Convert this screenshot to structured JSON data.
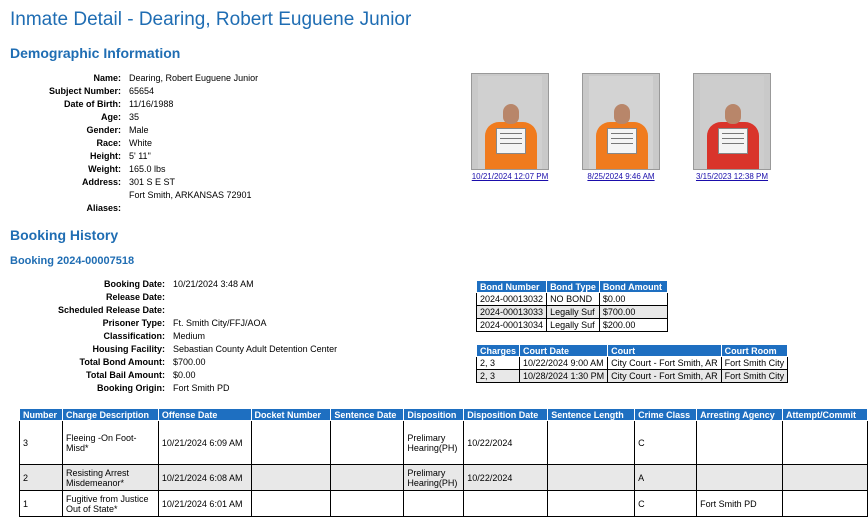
{
  "page_title": "Inmate Detail - Dearing, Robert Euguene Junior",
  "demographic": {
    "heading": "Demographic Information",
    "rows": [
      {
        "label": "Name:",
        "value": "Dearing, Robert Euguene Junior"
      },
      {
        "label": "Subject Number:",
        "value": "65654"
      },
      {
        "label": "Date of Birth:",
        "value": "11/16/1988"
      },
      {
        "label": "Age:",
        "value": "35"
      },
      {
        "label": "Gender:",
        "value": "Male"
      },
      {
        "label": "Race:",
        "value": "White"
      },
      {
        "label": "Height:",
        "value": "5' 11\""
      },
      {
        "label": "Weight:",
        "value": "165.0 lbs"
      },
      {
        "label": "Address:",
        "value": "301 S E ST",
        "value2": "Fort Smith, ARKANSAS 72901"
      },
      {
        "label": "Aliases:",
        "value": ""
      }
    ]
  },
  "photos": [
    {
      "caption": "10/21/2024 12:07 PM",
      "shirt": "#f07b1e",
      "wall": "#d0d0d0"
    },
    {
      "caption": "8/25/2024 9:46 AM",
      "shirt": "#f07b1e",
      "wall": "#d3d3d3"
    },
    {
      "caption": "3/15/2023 12:38 PM",
      "shirt": "#d9342b",
      "wall": "#cdcdcd"
    }
  ],
  "booking_history": {
    "heading": "Booking History",
    "booking_title": "Booking 2024-00007518",
    "rows": [
      {
        "label": "Booking Date:",
        "value": "10/21/2024 3:48 AM"
      },
      {
        "label": "Release Date:",
        "value": ""
      },
      {
        "label": "Scheduled Release Date:",
        "value": ""
      },
      {
        "label": "Prisoner Type:",
        "value": "Ft. Smith City/FFJ/AOA"
      },
      {
        "label": "Classification:",
        "value": "Medium"
      },
      {
        "label": "Housing Facility:",
        "value": "Sebastian County Adult Detention Center"
      },
      {
        "label": "Total Bond Amount:",
        "value": "$700.00"
      },
      {
        "label": "Total Bail Amount:",
        "value": "$0.00"
      },
      {
        "label": "Booking Origin:",
        "value": "Fort Smith PD"
      }
    ]
  },
  "bonds": {
    "headers": [
      "Bond Number",
      "Bond Type",
      "Bond Amount"
    ],
    "rows": [
      [
        "2024-00013032",
        "NO BOND",
        "$0.00"
      ],
      [
        "2024-00013033",
        "Legally Suf",
        "$700.00"
      ],
      [
        "2024-00013034",
        "Legally Suf",
        "$200.00"
      ]
    ]
  },
  "court": {
    "headers": [
      "Charges",
      "Court Date",
      "Court",
      "Court Room"
    ],
    "rows": [
      [
        "2, 3",
        "10/22/2024 9:00 AM",
        "City Court - Fort Smith, AR",
        "Fort Smith City"
      ],
      [
        "2, 3",
        "10/28/2024 1:30 PM",
        "City Court - Fort Smith, AR",
        "Fort Smith City"
      ]
    ]
  },
  "charges": {
    "headers": [
      "Number",
      "Charge Description",
      "Offense Date",
      "Docket Number",
      "Sentence Date",
      "Disposition",
      "Disposition Date",
      "Sentence Length",
      "Crime Class",
      "Arresting Agency",
      "Attempt/Commit"
    ],
    "rows": [
      [
        "3",
        "Fleeing -On Foot-Misd*",
        "10/21/2024 6:09 AM",
        "",
        "",
        "Prelimary Hearing(PH)",
        "10/22/2024",
        "",
        "C",
        "",
        ""
      ],
      [
        "2",
        "Resisting Arrest Misdemeanor*",
        "10/21/2024 6:08 AM",
        "",
        "",
        "Prelimary Hearing(PH)",
        "10/22/2024",
        "",
        "A",
        "",
        ""
      ],
      [
        "1",
        "Fugitive from Justice Out of State*",
        "10/21/2024 6:01 AM",
        "",
        "",
        "",
        "",
        "",
        "C",
        "Fort Smith PD",
        ""
      ]
    ]
  }
}
